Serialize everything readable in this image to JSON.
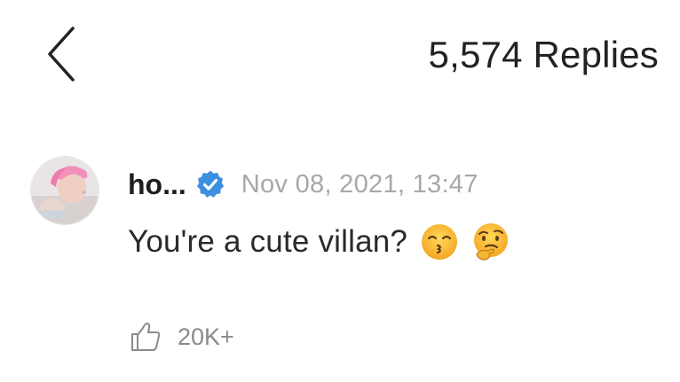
{
  "header": {
    "back_icon": "chevron-left-icon",
    "title": "5,574 Replies"
  },
  "comment": {
    "avatar_icon": "user-avatar",
    "username": "ho...",
    "verified_icon": "verified-badge-icon",
    "verified_color": "#3d8fe0",
    "timestamp": "Nov 08, 2021, 13:47",
    "text": "You're a cute villan?",
    "emojis": [
      "kissing-face-emoji",
      "thinking-face-emoji"
    ],
    "like_icon": "thumbs-up-icon",
    "like_count": "20K+"
  }
}
